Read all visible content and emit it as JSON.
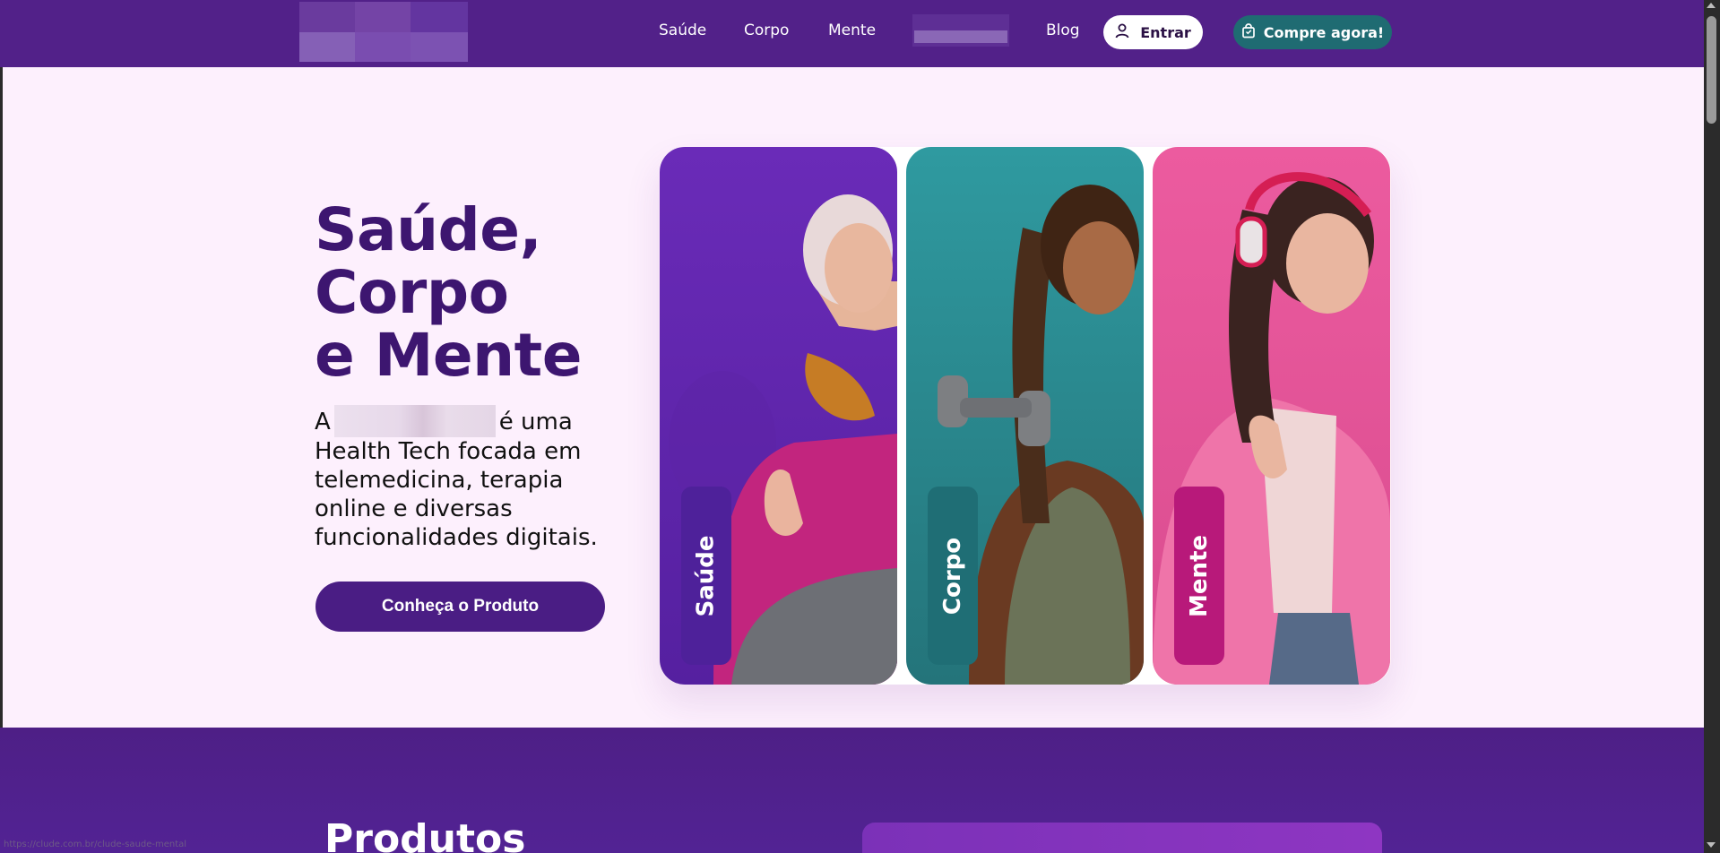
{
  "header": {
    "nav": [
      "Saúde",
      "Corpo",
      "Mente",
      "Blog"
    ],
    "login_label": "Entrar",
    "buy_label": "Compre agora!"
  },
  "hero": {
    "title": [
      "Saúde,",
      "Corpo",
      "e Mente"
    ],
    "desc_prefix": "A",
    "desc_suffix": "é uma Health Tech focada em telemedicina, terapia online e diversas funcionalidades digitais.",
    "cta": "Conheça o Produto"
  },
  "cards": [
    {
      "label": "Saúde",
      "color": "#6a2bb8",
      "tag_color": "#4e219a"
    },
    {
      "label": "Corpo",
      "color": "#2f9aa0",
      "tag_color": "#1f6e75"
    },
    {
      "label": "Mente",
      "color": "#ec5b9f",
      "tag_color": "#b8197a"
    }
  ],
  "products": {
    "title": "Produtos"
  },
  "status_bar": {
    "url": "https://clude.com.br/clude-saude-mental"
  },
  "colors": {
    "header_bg": "#522189",
    "hero_bg": "#fdf0fd",
    "title": "#3d1670",
    "cta_bg": "#4a1d84",
    "buy_bg": "#1f6b72"
  }
}
